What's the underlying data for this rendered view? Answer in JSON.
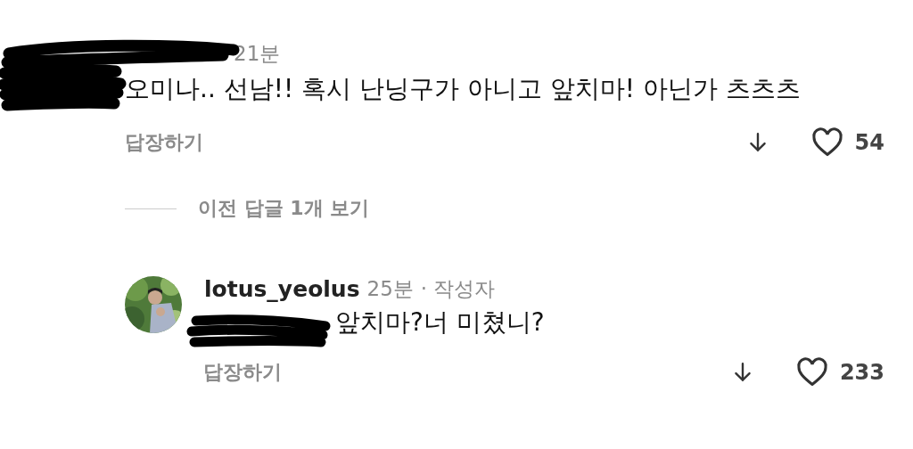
{
  "comments": [
    {
      "time": "21분",
      "body": "오미나.. 선남!! 혹시 난닝구가 아니고 앞치마! 아닌가 츠츠츠",
      "reply_label": "답장하기",
      "likes": "54",
      "liked": false
    },
    {
      "more_replies": "이전 답글 1개 보기"
    },
    {
      "username": "lotus_yeolus",
      "time": "25분",
      "author_badge": "· 작성자",
      "body": "앞치마?너 미쳤니?",
      "reply_label": "답장하기",
      "likes": "233",
      "liked": false
    }
  ]
}
